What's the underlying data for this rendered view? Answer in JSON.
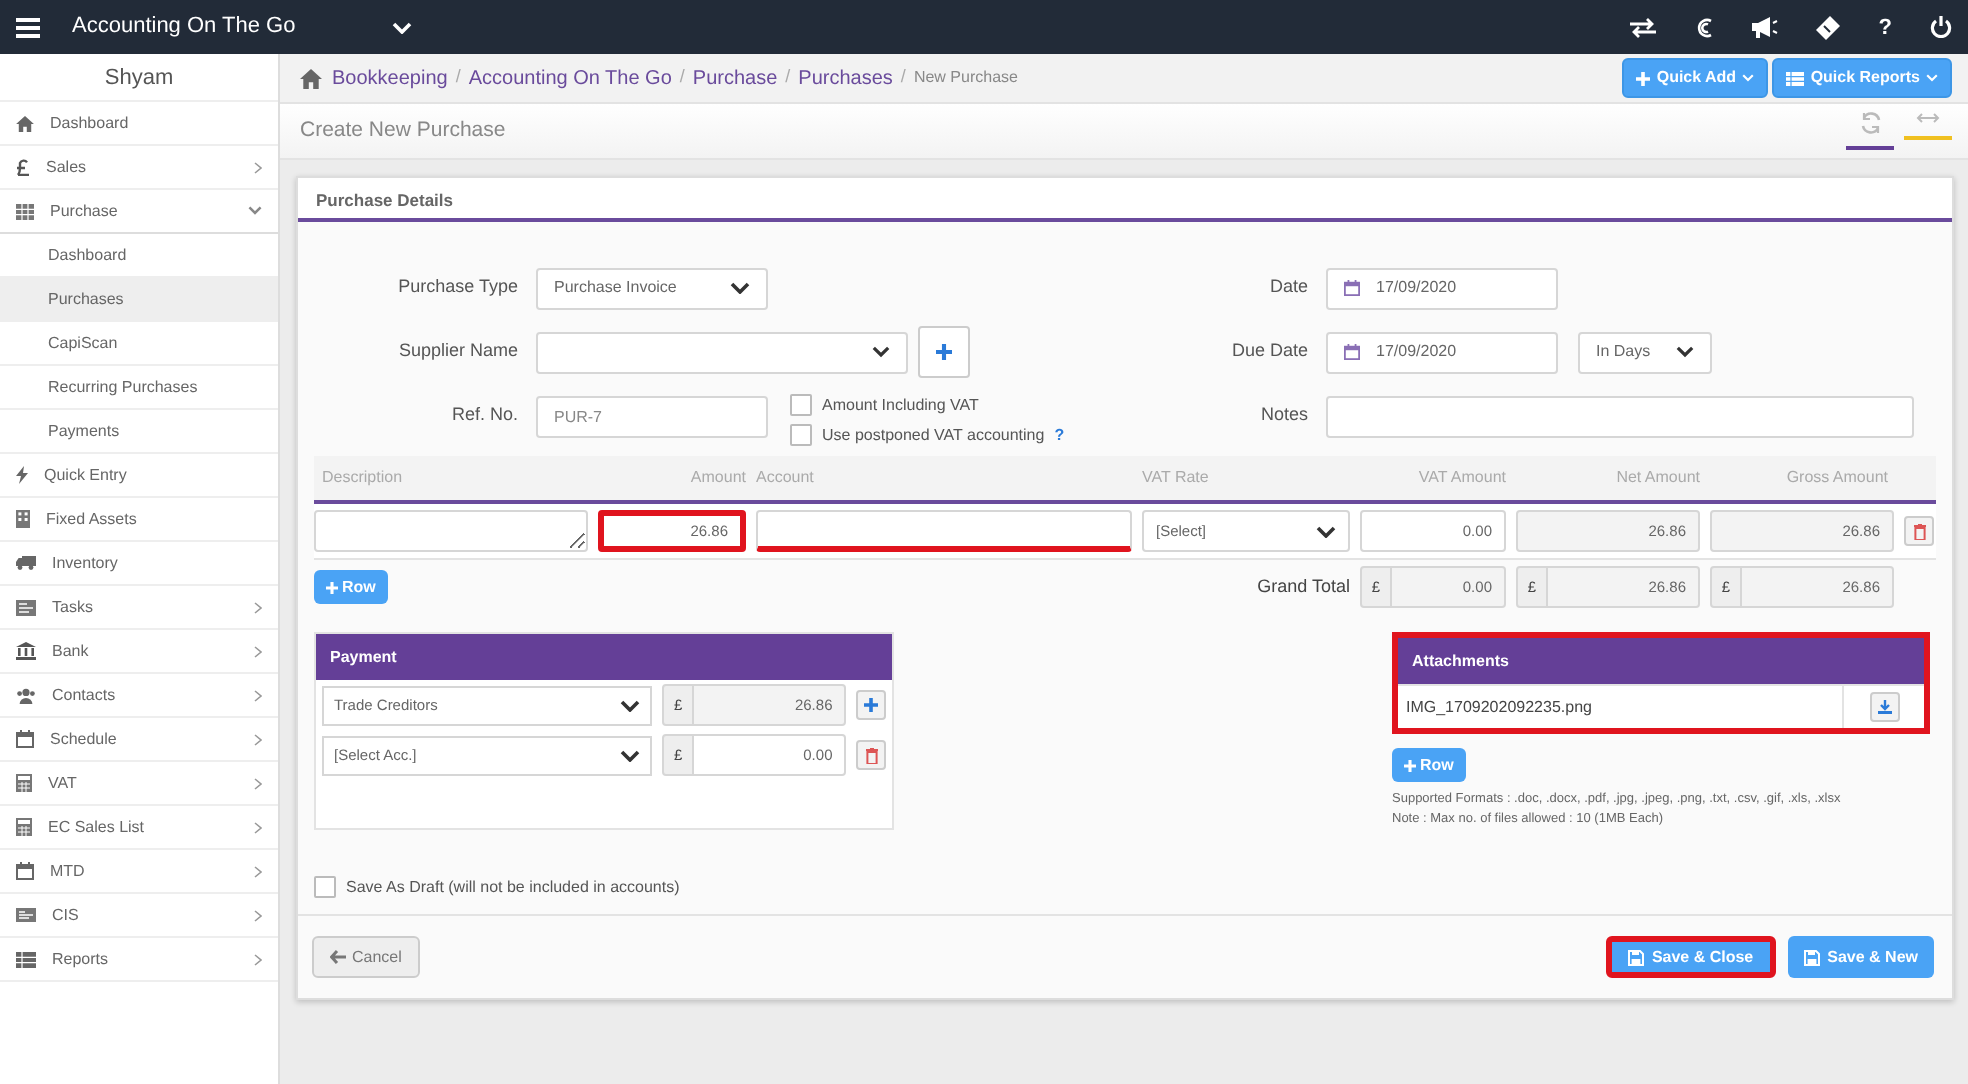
{
  "topbar": {
    "app_name": "Accounting On The Go",
    "help": "?"
  },
  "sidebar": {
    "user": "Shyam",
    "items": [
      {
        "label": "Dashboard",
        "kind": "home",
        "selected": false
      },
      {
        "label": "Sales",
        "kind": "pound",
        "selected": false,
        "expanded": false
      },
      {
        "label": "Purchase",
        "kind": "grid",
        "selected": false,
        "expanded": true,
        "children": [
          {
            "label": "Dashboard",
            "selected": false
          },
          {
            "label": "Purchases",
            "selected": true
          },
          {
            "label": "CapiScan",
            "selected": false
          },
          {
            "label": "Recurring Purchases",
            "selected": false
          },
          {
            "label": "Payments",
            "selected": false
          }
        ]
      },
      {
        "label": "Quick Entry",
        "kind": "bolt",
        "selected": false
      },
      {
        "label": "Fixed Assets",
        "kind": "building",
        "selected": false
      },
      {
        "label": "Inventory",
        "kind": "truck",
        "selected": false
      },
      {
        "label": "Tasks",
        "kind": "list",
        "selected": false,
        "expanded": false
      },
      {
        "label": "Bank",
        "kind": "bank",
        "selected": false,
        "expanded": false
      },
      {
        "label": "Contacts",
        "kind": "users",
        "selected": false,
        "expanded": false
      },
      {
        "label": "Schedule",
        "kind": "calendar",
        "selected": false,
        "expanded": false
      },
      {
        "label": "VAT",
        "kind": "calculator",
        "selected": false,
        "expanded": false
      },
      {
        "label": "EC Sales List",
        "kind": "calculator",
        "selected": false,
        "expanded": false
      },
      {
        "label": "MTD",
        "kind": "calendar",
        "selected": false,
        "expanded": false
      },
      {
        "label": "CIS",
        "kind": "card",
        "selected": false,
        "expanded": false
      },
      {
        "label": "Reports",
        "kind": "table",
        "selected": false,
        "expanded": false
      }
    ]
  },
  "breadcrumb": [
    {
      "label": "Bookkeeping",
      "separator": "/"
    },
    {
      "label": "Accounting On The Go",
      "separator": "/"
    },
    {
      "label": "Purchase",
      "separator": "/"
    },
    {
      "label": "Purchases",
      "separator": "/"
    },
    {
      "label": "New Purchase"
    }
  ],
  "quick_buttons": [
    "Quick Add",
    "Quick Reports"
  ],
  "page_title": "Create New Purchase",
  "card_title": "Purchase Details",
  "form": {
    "purchase_type": {
      "label": "Purchase Type",
      "value": "Purchase Invoice"
    },
    "supplier_name": {
      "label": "Supplier Name"
    },
    "ref_no": {
      "label": "Ref. No.",
      "value": "PUR-7"
    },
    "options": [
      {
        "label": "Amount Including VAT",
        "checked": false
      },
      {
        "label": "Use postponed VAT accounting",
        "checked": false,
        "help": "?"
      }
    ],
    "date": {
      "label": "Date",
      "value": "17/09/2020"
    },
    "due_date": {
      "label": "Due Date",
      "value": "17/09/2020",
      "terms": "In Days"
    },
    "notes": {
      "label": "Notes"
    }
  },
  "lines": {
    "columns": [
      "Description",
      "Amount",
      "Account",
      "VAT Rate",
      "VAT Amount",
      "Net Amount",
      "Gross Amount"
    ],
    "rows": [
      {
        "amount": "26.86",
        "amount_highlighted": true,
        "account_highlighted": true,
        "vat_rate": "[Select]",
        "vat_amount": "0.00",
        "net_amount": "26.86",
        "gross_amount": "26.86"
      }
    ],
    "add_row": "Row",
    "grand_total": {
      "label": "Grand Total",
      "currency": "£",
      "vat_amount": "0.00",
      "net_amount": "26.86",
      "gross_amount": "26.86"
    }
  },
  "payment": {
    "title": "Payment",
    "rows": [
      {
        "account": "Trade Creditors",
        "currency": "£",
        "amount": "26.86",
        "kind": "add"
      },
      {
        "account": "[Select Acc.]",
        "currency": "£",
        "amount": "0.00",
        "kind": "delete"
      }
    ]
  },
  "attachments": {
    "title": "Attachments",
    "highlighted": true,
    "files": [
      "IMG_1709202092235.png"
    ],
    "add_row": "Row",
    "notes": [
      "Supported Formats : .doc, .docx, .pdf, .jpg, .jpeg, .png, .txt, .csv, .gif, .xls, .xlsx",
      "Note : Max no. of files allowed : 10 (1MB Each)"
    ]
  },
  "draft": {
    "label": "Save As Draft (will not be included in accounts)",
    "checked": false
  },
  "footer": {
    "cancel": "Cancel",
    "save_close": {
      "label": "Save & Close",
      "highlighted": true
    },
    "save_new": {
      "label": "Save & New",
      "highlighted": false
    }
  }
}
